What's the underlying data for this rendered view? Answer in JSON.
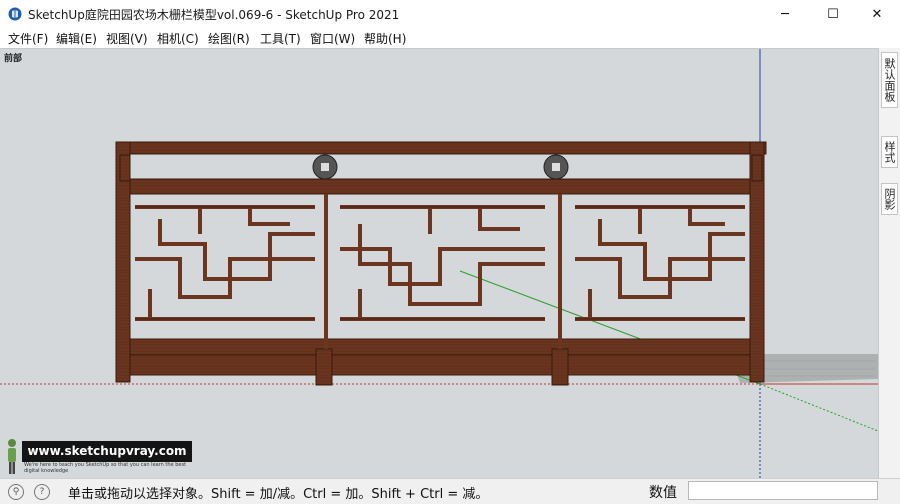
{
  "window": {
    "title": "SketchUp庭院田园农场木栅栏模型vol.069-6 - SketchUp Pro 2021",
    "minimize_glyph": "─",
    "maximize_glyph": "☐",
    "close_glyph": "✕"
  },
  "menu": [
    {
      "label": "文件(F)"
    },
    {
      "label": "编辑(E)"
    },
    {
      "label": "视图(V)"
    },
    {
      "label": "相机(C)"
    },
    {
      "label": "绘图(R)"
    },
    {
      "label": "工具(T)"
    },
    {
      "label": "窗口(W)"
    },
    {
      "label": "帮助(H)"
    }
  ],
  "viewport": {
    "scene_label": "前部",
    "background_color": "#d4d8da",
    "wood_color": "#6b3520"
  },
  "tray": {
    "tabs": [
      {
        "label": "默认面板"
      },
      {
        "label": "样式"
      },
      {
        "label": "阴影"
      }
    ]
  },
  "watermark": {
    "title": "www.sketchupvray.com",
    "subtitle": "We're here to teach you SketchUp so that you can learn the best digital knowledge"
  },
  "status": {
    "icons": [
      "info-pin-icon",
      "help-icon"
    ],
    "text": "单击或拖动以选择对象。Shift = 加/减。Ctrl = 加。Shift + Ctrl = 减。",
    "measurements_label": "数值",
    "measurements_value": ""
  }
}
